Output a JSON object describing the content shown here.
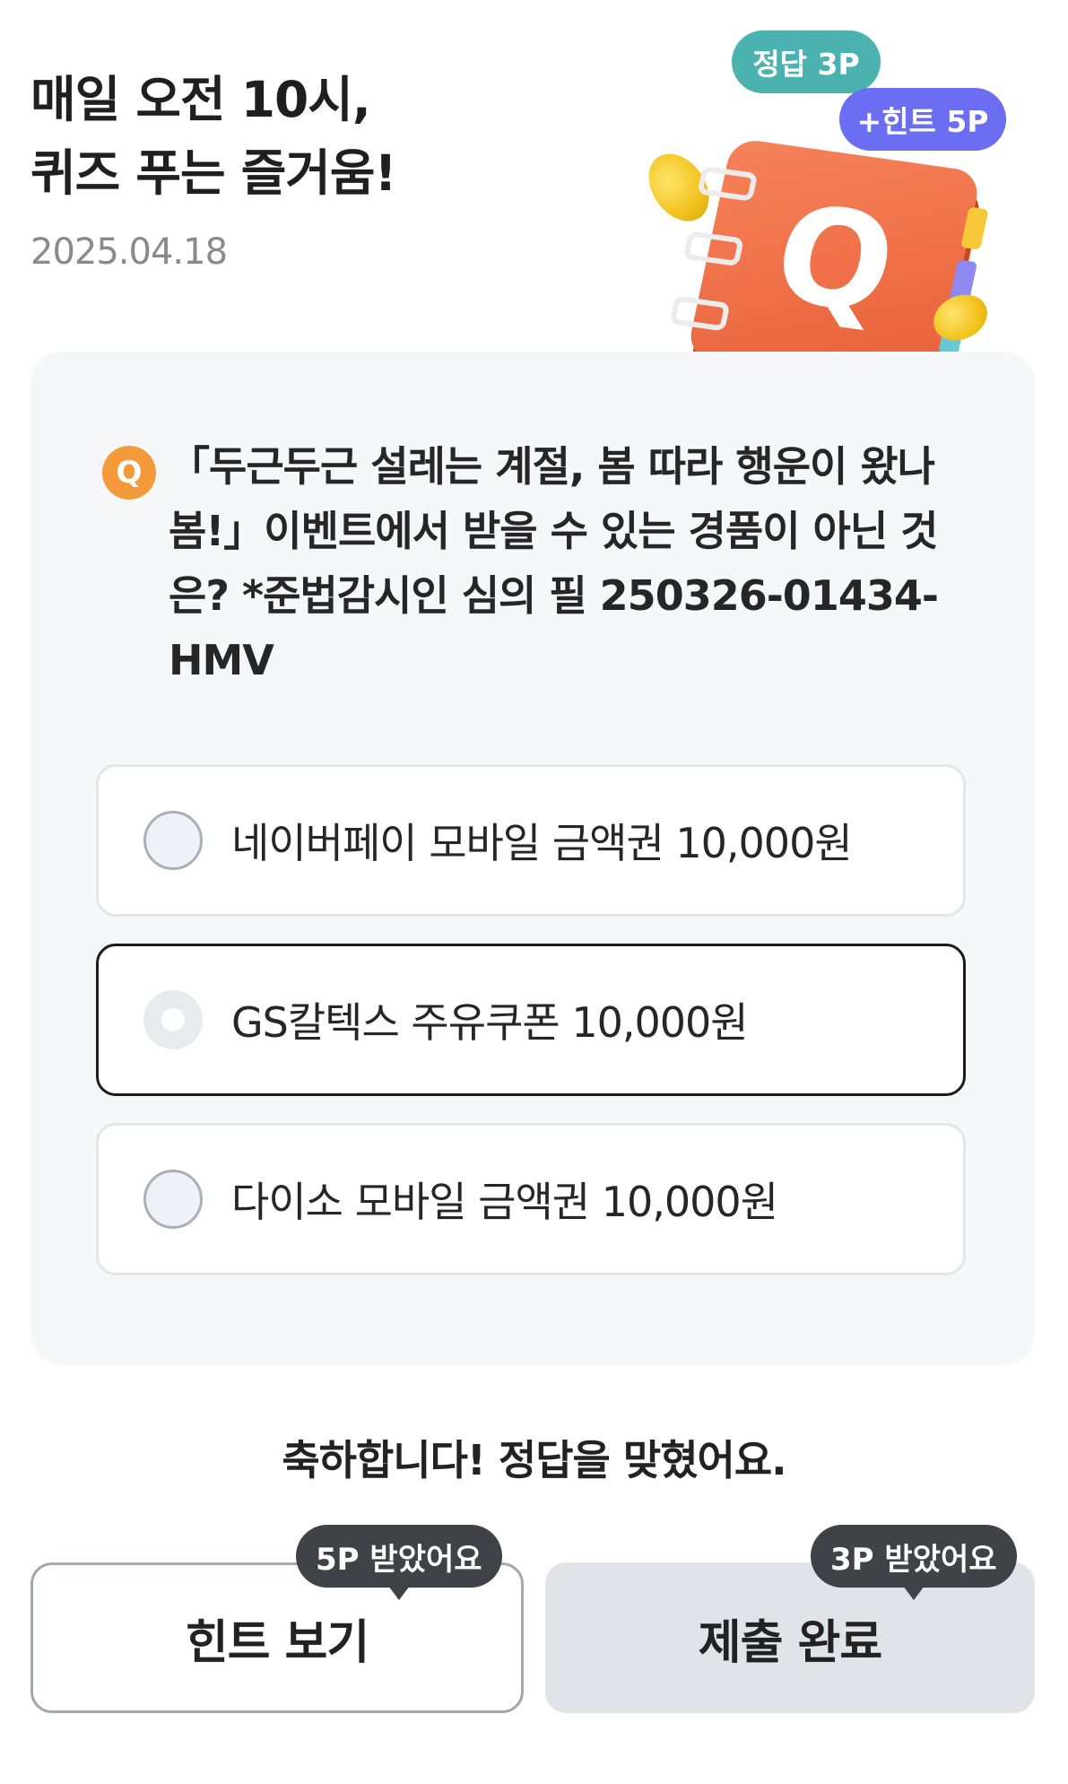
{
  "header": {
    "title_line1": "매일 오전 10시,",
    "title_line2": "퀴즈 푸는 즐거움!",
    "date": "2025.04.18"
  },
  "illustration": {
    "bubble_correct": "정답 3P",
    "bubble_hint": "+힌트 5P",
    "book_letter": "Q",
    "colors": {
      "correct": "#4cb2b0",
      "hint": "#6b6df3",
      "book": "#f07248"
    }
  },
  "quiz": {
    "badge": "Q",
    "question": "「두근두근 설레는 계절, 봄 따라 행운이 왔나봄!」이벤트에서 받을 수 있는 경품이 아닌 것은? *준법감시인 심의 필 250326-01434-HMV",
    "options": [
      {
        "label": "네이버페이 모바일 금액권 10,000원",
        "selected": false
      },
      {
        "label": "GS칼텍스 주유쿠폰 10,000원",
        "selected": true
      },
      {
        "label": "다이소 모바일 금액권 10,000원",
        "selected": false
      }
    ]
  },
  "result_message": "축하합니다! 정답을 맞혔어요.",
  "buttons": {
    "hint_label": "힌트 보기",
    "hint_tooltip": "5P 받았어요",
    "submit_label": "제출 완료",
    "submit_tooltip": "3P 받았어요"
  }
}
